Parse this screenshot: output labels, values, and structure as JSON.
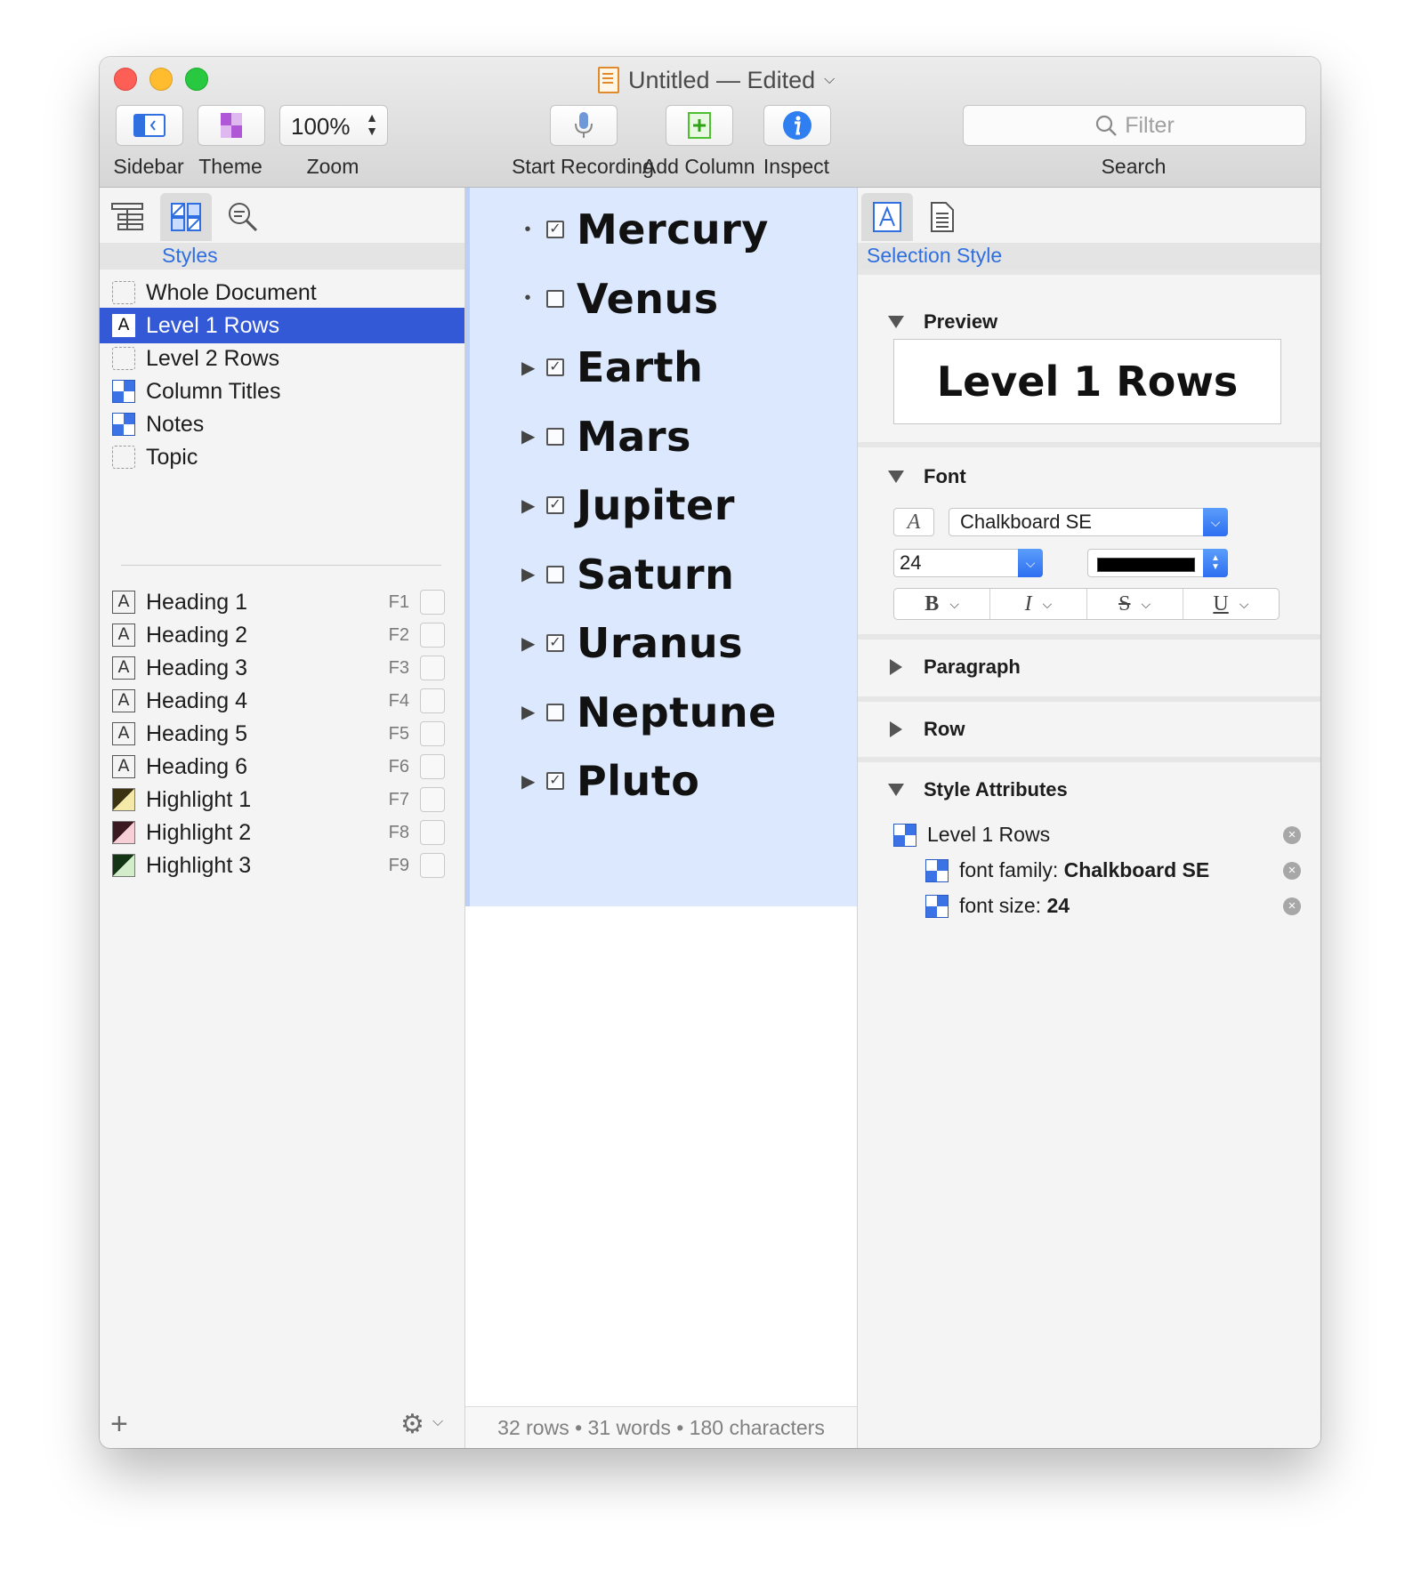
{
  "window": {
    "title": "Untitled — Edited"
  },
  "toolbar": {
    "sidebar_label": "Sidebar",
    "theme_label": "Theme",
    "zoom_value": "100%",
    "zoom_label": "Zoom",
    "record_label": "Start Recording",
    "add_column_label": "Add Column",
    "inspect_label": "Inspect",
    "filter_placeholder": "Filter",
    "search_label": "Search"
  },
  "sidebar": {
    "section_title": "Styles",
    "styles": [
      {
        "label": "Whole Document",
        "icon": "dashed-box-icon"
      },
      {
        "label": "Level 1 Rows",
        "icon": "letter-a-icon",
        "selected": true
      },
      {
        "label": "Level 2 Rows",
        "icon": "dashed-box-icon"
      },
      {
        "label": "Column Titles",
        "icon": "checker-icon"
      },
      {
        "label": "Notes",
        "icon": "checker-icon"
      },
      {
        "label": "Topic",
        "icon": "dashed-box-icon"
      }
    ],
    "named_styles": [
      {
        "label": "Heading 1",
        "key": "F1"
      },
      {
        "label": "Heading 2",
        "key": "F2"
      },
      {
        "label": "Heading 3",
        "key": "F3"
      },
      {
        "label": "Heading 4",
        "key": "F4"
      },
      {
        "label": "Heading 5",
        "key": "F5"
      },
      {
        "label": "Heading 6",
        "key": "F6"
      },
      {
        "label": "Highlight 1",
        "key": "F7",
        "color": "#f5e9a8",
        "dark": "#3a3210"
      },
      {
        "label": "Highlight 2",
        "key": "F8",
        "color": "#f7cfd6",
        "dark": "#3a1a20"
      },
      {
        "label": "Highlight 3",
        "key": "F9",
        "color": "#d3ecc9",
        "dark": "#143416"
      }
    ]
  },
  "outline": {
    "rows": [
      {
        "text": "Mercury",
        "handle": "•",
        "checked": true
      },
      {
        "text": "Venus",
        "handle": "•",
        "checked": false
      },
      {
        "text": "Earth",
        "handle": "▶",
        "checked": true
      },
      {
        "text": "Mars",
        "handle": "▶",
        "checked": false
      },
      {
        "text": "Jupiter",
        "handle": "▶",
        "checked": true
      },
      {
        "text": "Saturn",
        "handle": "▶",
        "checked": false
      },
      {
        "text": "Uranus",
        "handle": "▶",
        "checked": true
      },
      {
        "text": "Neptune",
        "handle": "▶",
        "checked": false
      },
      {
        "text": "Pluto",
        "handle": "▶",
        "checked": true
      }
    ],
    "status": "32 rows • 31 words • 180 characters"
  },
  "inspector": {
    "section_title": "Selection Style",
    "preview_label": "Preview",
    "preview_text": "Level 1 Rows",
    "font_label": "Font",
    "font_family": "Chalkboard SE",
    "font_size": "24",
    "text_color": "#000000",
    "style_buttons": [
      "B",
      "I",
      "S",
      "U"
    ],
    "paragraph_label": "Paragraph",
    "row_label": "Row",
    "attributes_label": "Style Attributes",
    "attr_style": "Level 1 Rows",
    "attr_family_key": "font family: ",
    "attr_family_val": "Chalkboard SE",
    "attr_size_key": "font size: ",
    "attr_size_val": "24"
  }
}
